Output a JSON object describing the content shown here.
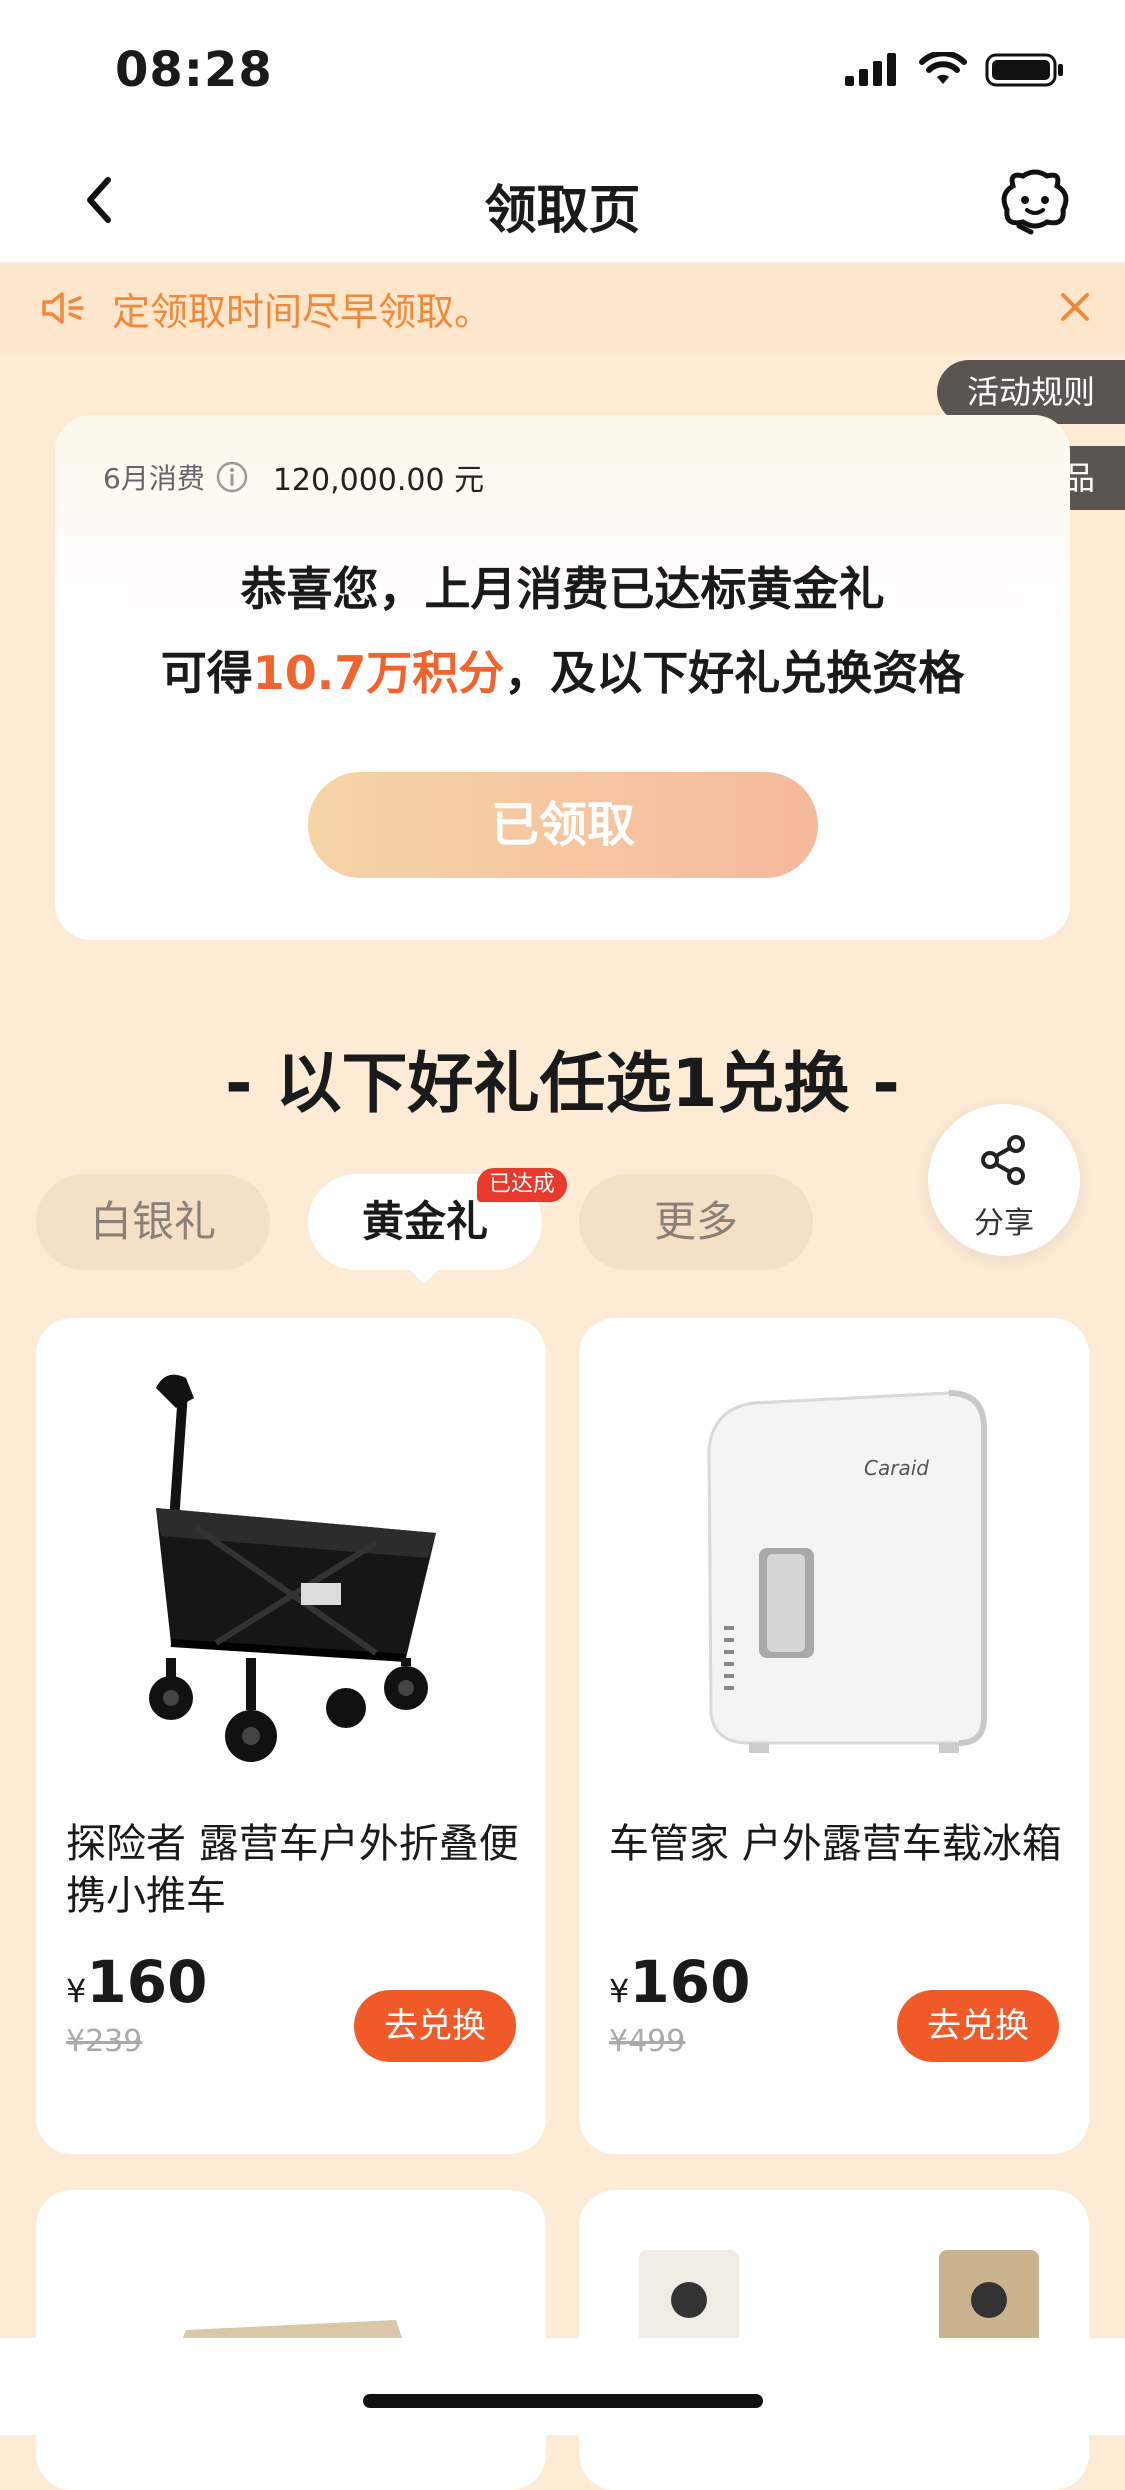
{
  "status_bar": {
    "time": "08:28"
  },
  "nav": {
    "title": "领取页"
  },
  "notice": {
    "text": "‌定领取时间尽早领取。"
  },
  "side_buttons": {
    "rules": "活动规则",
    "history": "历史奖品"
  },
  "summary": {
    "spend_label": "6月消费",
    "spend_value": "120,000.00 元",
    "line1": "恭喜您，上月消费已达标黄金礼",
    "line2_prefix": "可得",
    "line2_highlight": "10.7万积分",
    "line2_suffix": "，及以下好礼兑换资格",
    "claimed_button": "已领取"
  },
  "section": {
    "title": "- 以下好礼任选1兑换 -"
  },
  "share": {
    "label": "分享"
  },
  "tabs": [
    {
      "label": "白银礼",
      "active": false
    },
    {
      "label": "黄金礼",
      "active": true,
      "badge": "已达成"
    },
    {
      "label": "更多",
      "active": false
    }
  ],
  "products": [
    {
      "name": "探险者 露营车户外折叠便携小推车",
      "currency": "¥",
      "price": "160",
      "original_price": "¥239",
      "button": "去兑换",
      "image": "folding-wagon-icon"
    },
    {
      "name": "车管家 户外露营车载冰箱",
      "currency": "¥",
      "price": "160",
      "original_price": "¥499",
      "button": "去兑换",
      "image": "mini-fridge-icon",
      "brand": "Caraid"
    }
  ],
  "colors": {
    "accent": "#f05a28",
    "background": "#fdebd6",
    "notice_text": "#f08a3a",
    "badge": "#e8392d"
  }
}
